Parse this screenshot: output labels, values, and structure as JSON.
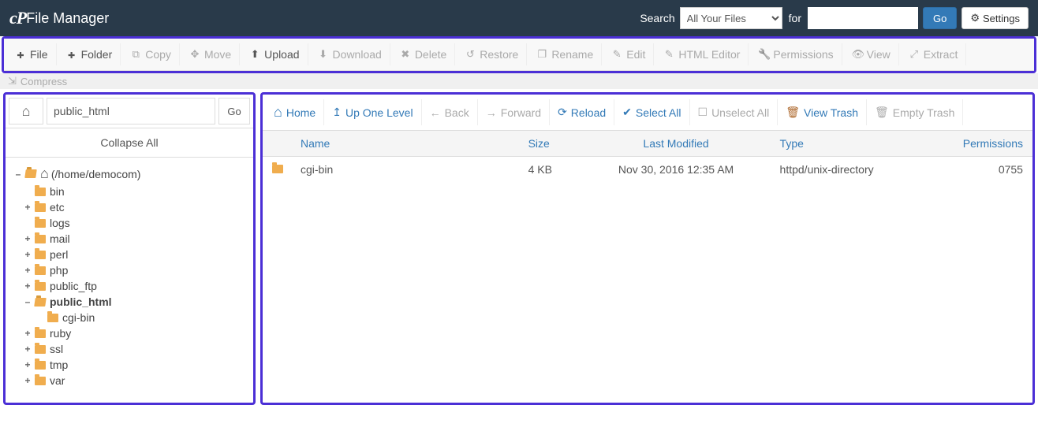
{
  "header": {
    "app_title": "File Manager",
    "search_label": "Search",
    "search_scope_selected": "All Your Files",
    "for_label": "for",
    "search_value": "",
    "go_label": "Go",
    "settings_label": "Settings"
  },
  "toolbar": {
    "file": "File",
    "folder": "Folder",
    "copy": "Copy",
    "move": "Move",
    "upload": "Upload",
    "download": "Download",
    "delete": "Delete",
    "restore": "Restore",
    "rename": "Rename",
    "edit": "Edit",
    "html_editor": "HTML Editor",
    "permissions": "Permissions",
    "view": "View",
    "extract": "Extract",
    "compress": "Compress"
  },
  "sidebar": {
    "path_value": "public_html",
    "go_label": "Go",
    "collapse_label": "Collapse All",
    "tree": {
      "root_label": "(/home/democom)",
      "items": [
        {
          "label": "bin",
          "expandable": false
        },
        {
          "label": "etc",
          "expandable": true
        },
        {
          "label": "logs",
          "expandable": false
        },
        {
          "label": "mail",
          "expandable": true
        },
        {
          "label": "perl",
          "expandable": true
        },
        {
          "label": "php",
          "expandable": true
        },
        {
          "label": "public_ftp",
          "expandable": true
        },
        {
          "label": "public_html",
          "expandable": true,
          "expanded": true,
          "active": true,
          "children": [
            {
              "label": "cgi-bin",
              "expandable": false
            }
          ]
        },
        {
          "label": "ruby",
          "expandable": true
        },
        {
          "label": "ssl",
          "expandable": true
        },
        {
          "label": "tmp",
          "expandable": true
        },
        {
          "label": "var",
          "expandable": true
        }
      ]
    }
  },
  "actionbar": {
    "home": "Home",
    "up": "Up One Level",
    "back": "Back",
    "forward": "Forward",
    "reload": "Reload",
    "select_all": "Select All",
    "unselect_all": "Unselect All",
    "view_trash": "View Trash",
    "empty_trash": "Empty Trash"
  },
  "table": {
    "headers": {
      "name": "Name",
      "size": "Size",
      "modified": "Last Modified",
      "type": "Type",
      "permissions": "Permissions"
    },
    "rows": [
      {
        "name": "cgi-bin",
        "size": "4 KB",
        "modified": "Nov 30, 2016 12:35 AM",
        "type": "httpd/unix-directory",
        "permissions": "0755"
      }
    ]
  }
}
